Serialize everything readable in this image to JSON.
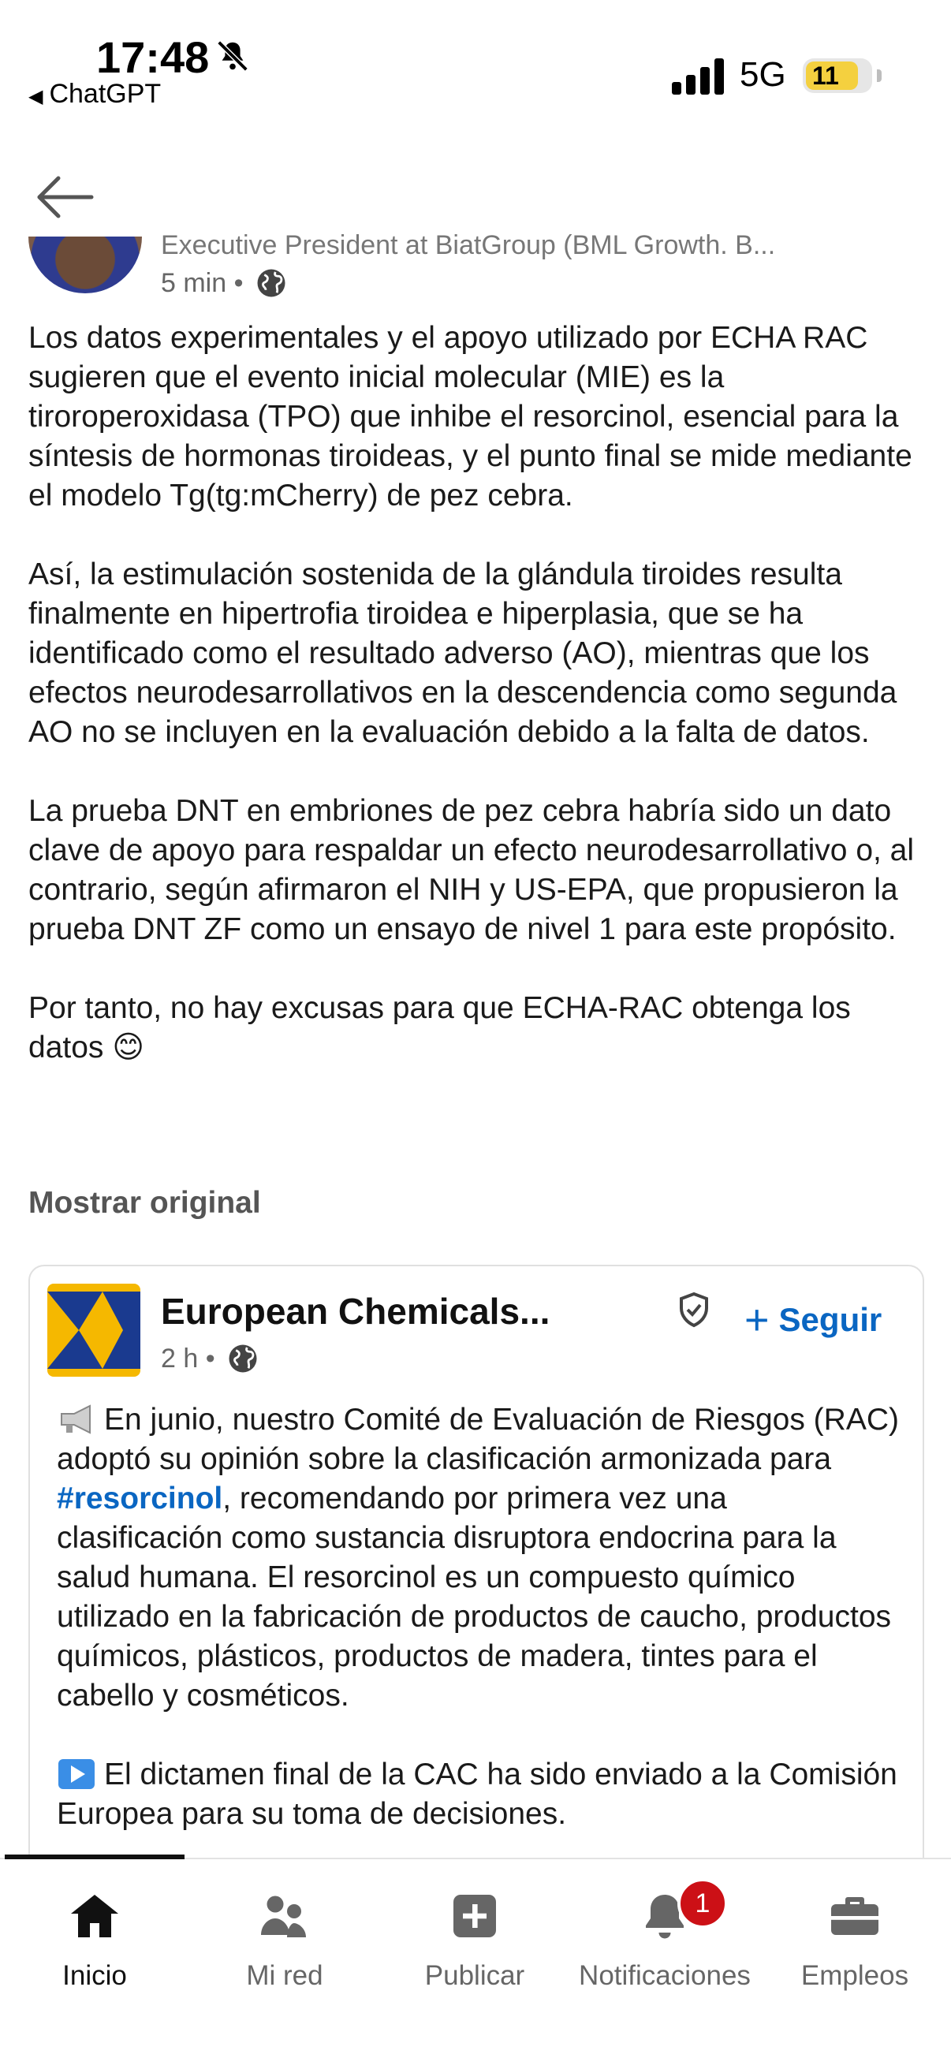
{
  "status_bar": {
    "time": "17:48",
    "back_app": "ChatGPT",
    "network": "5G",
    "battery": "11"
  },
  "author": {
    "headline": "Executive President at BiatGroup (BML Growth. B...",
    "time": "5 min"
  },
  "post": {
    "paragraphs": [
      "Los datos experimentales y el apoyo utilizado por ECHA RAC sugieren que el evento inicial molecular (MIE) es la tiroroperoxidasa (TPO) que inhibe el resorcinol, esencial para la síntesis de hormonas tiroideas, y el punto final se mide mediante el modelo Tg(tg:mCherry) de pez cebra.",
      "Así, la estimulación sostenida de la glándula tiroides resulta finalmente en hipertrofia tiroidea e hiperplasia, que se ha identificado como el resultado adverso (AO), mientras que los efectos neurodesarrollativos en la descendencia como segunda AO no se incluyen en la evaluación debido a la falta de datos.",
      "La prueba DNT en embriones de pez cebra habría sido un dato clave de apoyo para respaldar un efecto neurodesarrollativo o, al contrario, según afirmaron el NIH y US-EPA, que propusieron la prueba DNT ZF como un ensayo de nivel 1 para este propósito.",
      "Por tanto, no hay excusas para que ECHA-RAC obtenga los datos 😊"
    ],
    "show_original": "Mostrar original"
  },
  "shared_card": {
    "org_name": "European Chemicals...",
    "time": "2 h",
    "follow_label": "Seguir",
    "p1_before": "En junio, nuestro Comité de Evaluación de Riesgos (RAC) adoptó su opinión sobre la clasificación armonizada para ",
    "hashtag": "#resorcinol",
    "p1_after": ", recomendando por primera vez una clasificación como sustancia disruptora endocrina para la salud humana. El resorcinol es un compuesto químico utilizado en la fabricación de productos de caucho, productos químicos, plásticos, productos de madera, tintes para el cabello y cosméticos.",
    "p2": "El dictamen final de la CAC ha sido enviado a la Comisión Europea para su toma de decisiones."
  },
  "tabs": [
    {
      "label": "Inicio",
      "icon": "home-icon",
      "active": true
    },
    {
      "label": "Mi red",
      "icon": "network-icon"
    },
    {
      "label": "Publicar",
      "icon": "post-icon"
    },
    {
      "label": "Notificaciones",
      "icon": "bell-icon",
      "badge": "1"
    },
    {
      "label": "Empleos",
      "icon": "briefcase-icon"
    }
  ],
  "colors": {
    "link": "#0a66c2",
    "badge": "#cc1016",
    "battery": "#f4d03f"
  }
}
